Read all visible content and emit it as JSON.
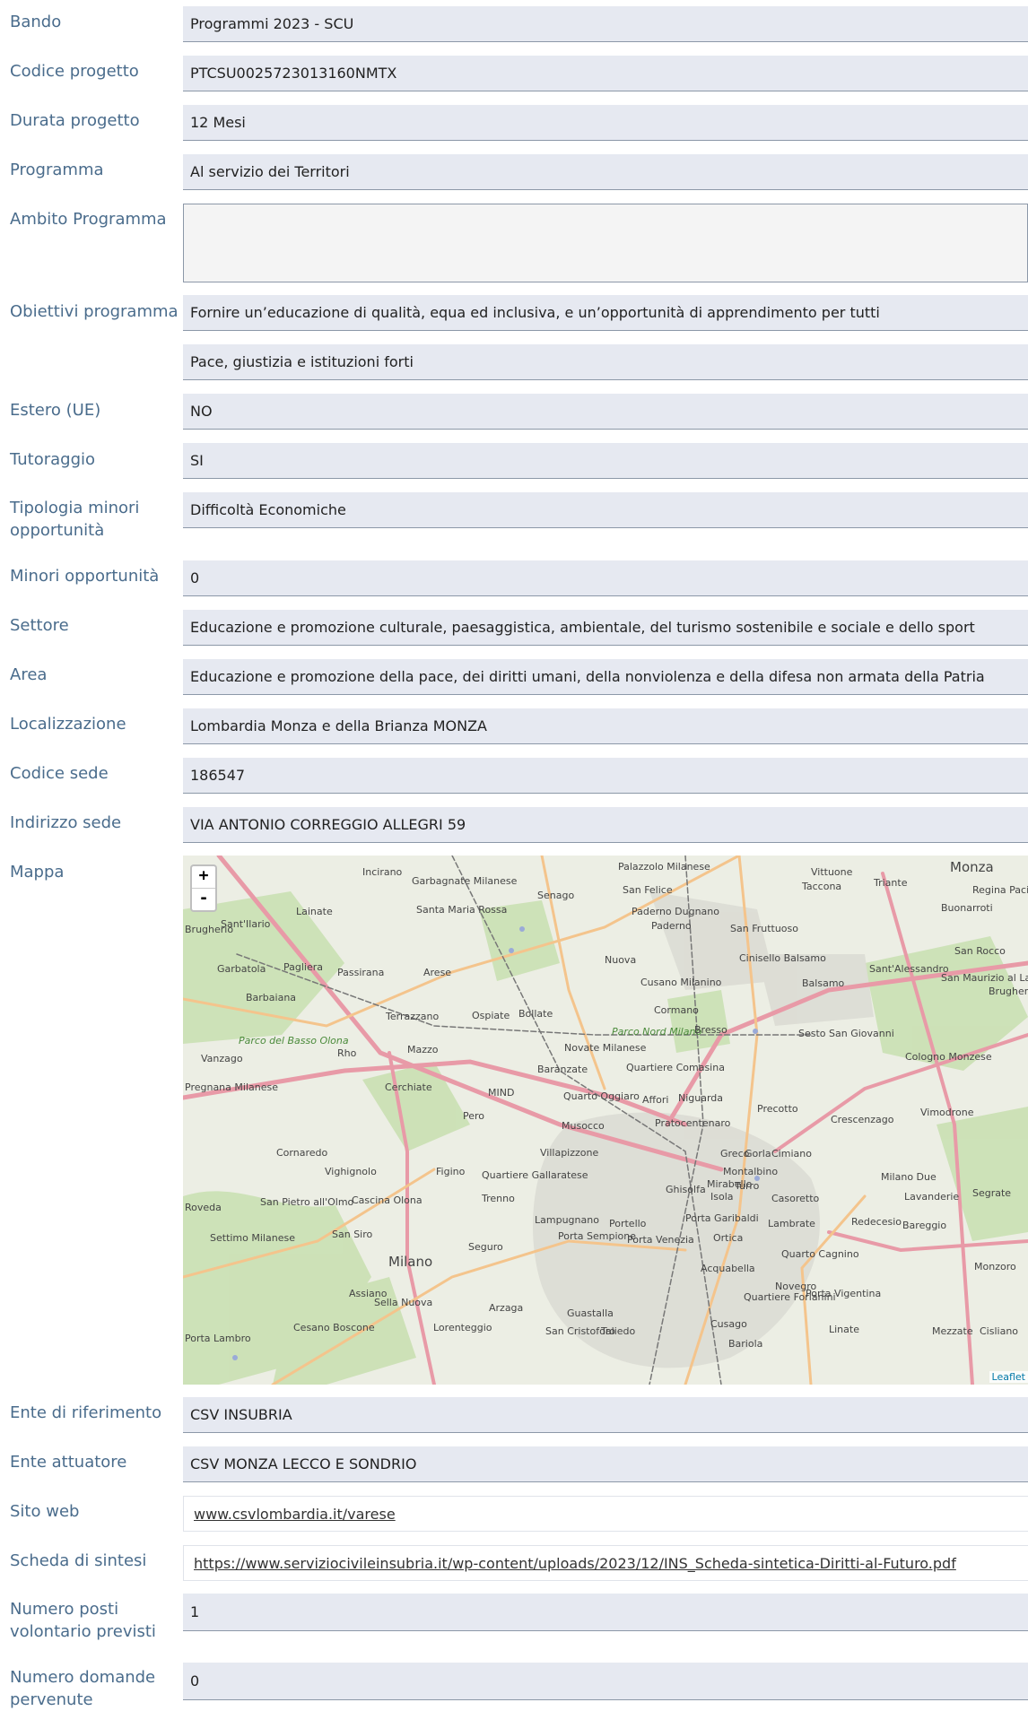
{
  "fields": {
    "bando": {
      "label": "Bando",
      "value": "Programmi 2023 - SCU"
    },
    "codice_progetto": {
      "label": "Codice progetto",
      "value": "PTCSU0025723013160NMTX"
    },
    "durata_progetto": {
      "label": "Durata progetto",
      "value": "12 Mesi"
    },
    "programma": {
      "label": "Programma",
      "value": "Al servizio dei Territori"
    },
    "ambito_programma": {
      "label": "Ambito Programma",
      "value": ""
    },
    "obiettivi_programma": {
      "label": "Obiettivi programma",
      "values": [
        "Fornire un’educazione di qualità, equa ed inclusiva, e un’opportunità di apprendimento per tutti",
        "Pace, giustizia e istituzioni forti"
      ]
    },
    "estero": {
      "label": "Estero (UE)",
      "value": "NO"
    },
    "tutoraggio": {
      "label": "Tutoraggio",
      "value": "SI"
    },
    "tipologia_minori": {
      "label": "Tipologia minori opportunità",
      "value": "Difficoltà Economiche"
    },
    "minori_opportunita": {
      "label": "Minori opportunità",
      "value": "0"
    },
    "settore": {
      "label": "Settore",
      "value": "Educazione e promozione culturale, paesaggistica, ambientale, del turismo sostenibile e sociale e dello sport"
    },
    "area": {
      "label": "Area",
      "value": "Educazione e promozione della pace, dei diritti umani, della nonviolenza e della difesa non armata della Patria"
    },
    "localizzazione": {
      "label": "Localizzazione",
      "value": "Lombardia Monza e della Brianza MONZA"
    },
    "codice_sede": {
      "label": "Codice sede",
      "value": "186547"
    },
    "indirizzo_sede": {
      "label": "Indirizzo sede",
      "value": "VIA ANTONIO CORREGGIO ALLEGRI 59"
    },
    "mappa": {
      "label": "Mappa"
    },
    "ente_riferimento": {
      "label": "Ente di riferimento",
      "value": "CSV INSUBRIA"
    },
    "ente_attuatore": {
      "label": "Ente attuatore",
      "value": "CSV MONZA LECCO E SONDRIO"
    },
    "sito_web": {
      "label": "Sito web",
      "value": "www.csvlombardia.it/varese"
    },
    "scheda_sintesi": {
      "label": "Scheda di sintesi",
      "value": "https://www.serviziocivileinsubria.it/wp-content/uploads/2023/12/INS_Scheda-sintetica-Diritti-al-Futuro.pdf"
    },
    "numero_posti": {
      "label": "Numero posti volontario previsti",
      "value": "1"
    },
    "numero_domande": {
      "label": "Numero domande pervenute",
      "value": "0"
    }
  },
  "map": {
    "zoom_in": "+",
    "zoom_out": "-",
    "attribution": "Leaflet",
    "places": [
      "Garbagnate Milanese",
      "Senago",
      "Palazzolo Milanese",
      "Paderno Dugnano",
      "Taccona",
      "Triante",
      "Monza",
      "Regina Pacis",
      "Buonarroti",
      "Lainate",
      "Santa Maria Rossa",
      "Paderno",
      "San Fruttuoso",
      "Cinisello Balsamo",
      "Sant'Alessandro",
      "Garbatola",
      "Pagliera",
      "Passirana",
      "Arese",
      "Nuova",
      "Cusano Milanino",
      "Balsamo",
      "San Rocco",
      "San Maurizio al Lambro",
      "Brugherio",
      "Barbaiana",
      "Bollate",
      "Ospiate",
      "Terrazzano",
      "Cormano",
      "Parco Nord Milano",
      "Bresso",
      "Sesto San Giovanni",
      "Cologno Monzese",
      "Parco del Basso Olona",
      "Vanzago",
      "Rho",
      "Mazzo",
      "Novate Milanese",
      "Baranzate",
      "Quartiere Comasina",
      "Pregnana Milanese",
      "Cerchiate",
      "MIND",
      "Quarto Oggiaro",
      "Affori",
      "Niguarda",
      "Precotto",
      "Vimodrone",
      "Pero",
      "Musocco",
      "Pratocentenaro",
      "Crescenzago",
      "Cornaredo",
      "Villapizzone",
      "Greco",
      "Gorla",
      "Cimiano",
      "Vighignolo",
      "Figino",
      "Quartiere Gallaratese",
      "Montalbino",
      "Mirabello",
      "Milano Due",
      "Turro",
      "Roveda",
      "San Pietro all'Olmo",
      "Cascina Olona",
      "Trenno",
      "Ghisolfa",
      "Isola",
      "Casoretto",
      "Lavanderie",
      "Segrate",
      "Lampugnano",
      "Portello",
      "Porta Garibaldi",
      "Lambrate",
      "Redecesio",
      "Bareggio",
      "Settimo Milanese",
      "San Siro",
      "Porta Sempione",
      "Porta Venezia",
      "Ortica",
      "Quarto Cagnino",
      "Seguro",
      "Milano",
      "Acquabella",
      "Novegro",
      "Monzoro",
      "Assiano",
      "Sella Nuova",
      "Arzaga",
      "Guastalla",
      "Quartiere Forlanini",
      "Porta Vigentina",
      "Cusago",
      "Cesano Boscone",
      "Lorenteggio",
      "San Cristoforo",
      "Taliedo",
      "Linate",
      "Mezzate",
      "Cisliano",
      "Porta Lambro",
      "Bariola",
      "Incirano",
      "San Felice",
      "Vittuone",
      "Sant'Ilario",
      "Brugherio"
    ]
  }
}
